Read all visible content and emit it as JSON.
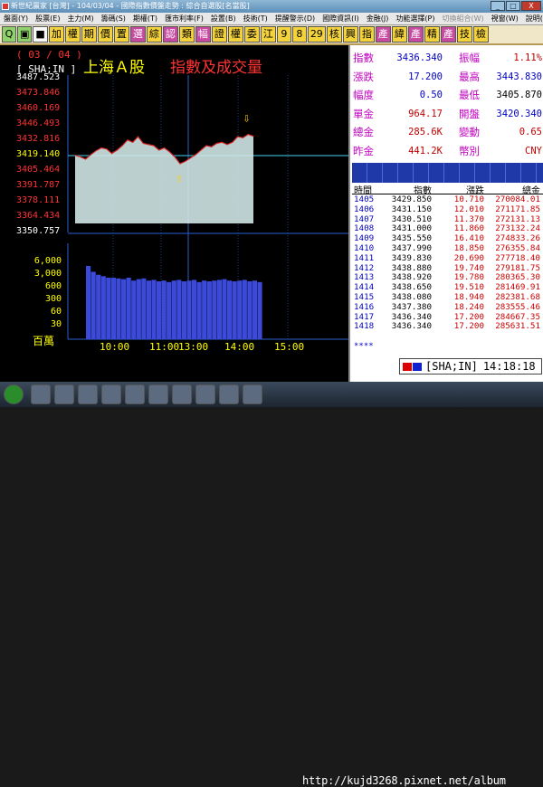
{
  "window": {
    "title": "新世紀贏家 [台灣] - 104/03/04 - 國際指數價盤走勢 : 綜合自選股[名當股]",
    "controls": [
      "_",
      "□",
      "X"
    ]
  },
  "menubar": {
    "items": [
      "盤面(Y)",
      "股票(E)",
      "主力(M)",
      "籌碼(S)",
      "期權(T)",
      "匯市利率(F)",
      "設置(B)",
      "技術(T)",
      "提醒警示(D)",
      "國際資訊(I)",
      "金融(J)",
      "功能選擇(P)",
      "切換組合(W)",
      "視窗(W)",
      "說明(H)"
    ],
    "dim_index": 12
  },
  "toolbar": {
    "buttons": [
      {
        "label": "Q",
        "style": "g"
      },
      {
        "label": "▣",
        "style": "g"
      },
      {
        "label": "■",
        "style": "w"
      },
      {
        "label": "加",
        "style": "y"
      },
      {
        "label": "權",
        "style": "y"
      },
      {
        "label": "期",
        "style": "y"
      },
      {
        "label": "價",
        "style": "y"
      },
      {
        "label": "置",
        "style": "y"
      },
      {
        "label": "選",
        "style": "hi"
      },
      {
        "label": "綜",
        "style": "y"
      },
      {
        "label": "認",
        "style": "hi"
      },
      {
        "label": "類",
        "style": "y"
      },
      {
        "label": "幅",
        "style": "hi"
      },
      {
        "label": "證",
        "style": "y"
      },
      {
        "label": "權",
        "style": "y"
      },
      {
        "label": "委",
        "style": "y"
      },
      {
        "label": "江",
        "style": "y"
      },
      {
        "label": "9",
        "style": "y"
      },
      {
        "label": "8",
        "style": "y"
      },
      {
        "label": "29",
        "style": "y"
      },
      {
        "label": "核",
        "style": "y"
      },
      {
        "label": "興",
        "style": "y"
      },
      {
        "label": "指",
        "style": "y"
      },
      {
        "label": "產",
        "style": "hi"
      },
      {
        "label": "緯",
        "style": "y"
      },
      {
        "label": "產",
        "style": "hi"
      },
      {
        "label": "精",
        "style": "y"
      },
      {
        "label": "產",
        "style": "hi"
      },
      {
        "label": "技",
        "style": "y"
      },
      {
        "label": "檢",
        "style": "y"
      }
    ]
  },
  "chart": {
    "date": "( 03 / 04 )",
    "code": "[ SHA;IN ]",
    "title_market": "上海Ａ股",
    "title_desc": "指數及成交量",
    "price_labels": [
      {
        "text": "3487.523",
        "color": "#ffffff"
      },
      {
        "text": "3473.846",
        "color": "#ff3333"
      },
      {
        "text": "3460.169",
        "color": "#ff3333"
      },
      {
        "text": "3446.493",
        "color": "#ff3333"
      },
      {
        "text": "3432.816",
        "color": "#ff3333"
      },
      {
        "text": "3419.140",
        "color": "#ffff00"
      },
      {
        "text": "3405.464",
        "color": "#ff3333"
      },
      {
        "text": "3391.787",
        "color": "#ff3333"
      },
      {
        "text": "3378.111",
        "color": "#ff3333"
      },
      {
        "text": "3364.434",
        "color": "#ff3333"
      },
      {
        "text": "3350.757",
        "color": "#ffffff"
      }
    ],
    "volume_labels": [
      "6,000",
      "3,000",
      "600",
      "300",
      "60",
      "30"
    ],
    "volume_unit": "百萬",
    "time_labels": [
      "10:00",
      "11:00",
      "13:00",
      "14:00",
      "15:00"
    ]
  },
  "stats": [
    {
      "l1": "指數",
      "v1": "3436.340",
      "c1": "#0000c0",
      "l2": "振幅",
      "v2": "1.11%",
      "c2": "#c00000"
    },
    {
      "l1": "漲跌",
      "v1": "17.200",
      "c1": "#0000c0",
      "l2": "最高",
      "v2": "3443.830",
      "c2": "#0000c0"
    },
    {
      "l1": "幅度",
      "v1": "0.50",
      "c1": "#0000c0",
      "l2": "最低",
      "v2": "3405.870",
      "c2": "#000000"
    },
    {
      "l1": "單金",
      "v1": "964.17",
      "c1": "#c00000",
      "l2": "開盤",
      "v2": "3420.340",
      "c2": "#0000c0"
    },
    {
      "l1": "總金",
      "v1": "285.6K",
      "c1": "#c00000",
      "l2": "變動",
      "v2": "0.65",
      "c2": "#c00000"
    },
    {
      "l1": "昨金",
      "v1": "441.2K",
      "c1": "#c00000",
      "l2": "幣別",
      "v2": "CNY",
      "c2": "#c00000"
    }
  ],
  "tick_table": {
    "headers": [
      "時間",
      "指數",
      "漲跌",
      "總金"
    ],
    "rows": [
      [
        "1405",
        "3429.850",
        "10.710",
        "270084.01"
      ],
      [
        "1406",
        "3431.150",
        "12.010",
        "271171.85"
      ],
      [
        "1407",
        "3430.510",
        "11.370",
        "272131.13"
      ],
      [
        "1408",
        "3431.000",
        "11.860",
        "273132.24"
      ],
      [
        "1409",
        "3435.550",
        "16.410",
        "274833.26"
      ],
      [
        "1410",
        "3437.990",
        "18.850",
        "276355.84"
      ],
      [
        "1411",
        "3439.830",
        "20.690",
        "277718.40"
      ],
      [
        "1412",
        "3438.880",
        "19.740",
        "279181.75"
      ],
      [
        "1413",
        "3438.920",
        "19.780",
        "280365.30"
      ],
      [
        "1414",
        "3438.650",
        "19.510",
        "281469.91"
      ],
      [
        "1415",
        "3438.080",
        "18.940",
        "282381.68"
      ],
      [
        "1416",
        "3437.380",
        "18.240",
        "283555.46"
      ],
      [
        "1417",
        "3436.340",
        "17.200",
        "284667.35"
      ],
      [
        "1418",
        "3436.340",
        "17.200",
        "285631.51"
      ]
    ],
    "more": "****"
  },
  "statusbar": {
    "code": "SHA;IN",
    "time": "14:18:18"
  },
  "taskbar": {
    "watermark": "http://kujd3268.pixnet.net/album"
  },
  "chart_data": {
    "type": "line",
    "title": "指數及成交量",
    "reference": 3419.14,
    "ylim": [
      3350.757,
      3487.523
    ],
    "x_labels": [
      "10:00",
      "11:00",
      "13:00",
      "14:00",
      "15:00"
    ],
    "series": [
      {
        "name": "指數",
        "values": [
          3419.5,
          3418.0,
          3416.0,
          3420.0,
          3423.5,
          3426.0,
          3425.0,
          3421.0,
          3424.0,
          3428.0,
          3433.0,
          3431.0,
          3436.0,
          3430.0,
          3429.0,
          3428.0,
          3424.0,
          3426.0,
          3422.5,
          3418.0,
          3412.0,
          3414.0,
          3417.0,
          3420.0,
          3424.0,
          3428.0,
          3427.0,
          3430.0,
          3431.0,
          3429.0,
          3431.0,
          3436.0,
          3435.0,
          3438.0,
          3436.34
        ]
      },
      {
        "name": "成交量",
        "values": [
          100,
          92,
          88,
          86,
          84,
          84,
          83,
          82,
          84,
          80,
          82,
          83,
          80,
          81,
          79,
          80,
          78,
          80,
          81,
          79,
          80,
          81,
          78,
          80,
          79,
          80,
          81,
          82,
          80,
          79,
          80,
          81,
          79,
          80,
          78
        ]
      }
    ]
  }
}
